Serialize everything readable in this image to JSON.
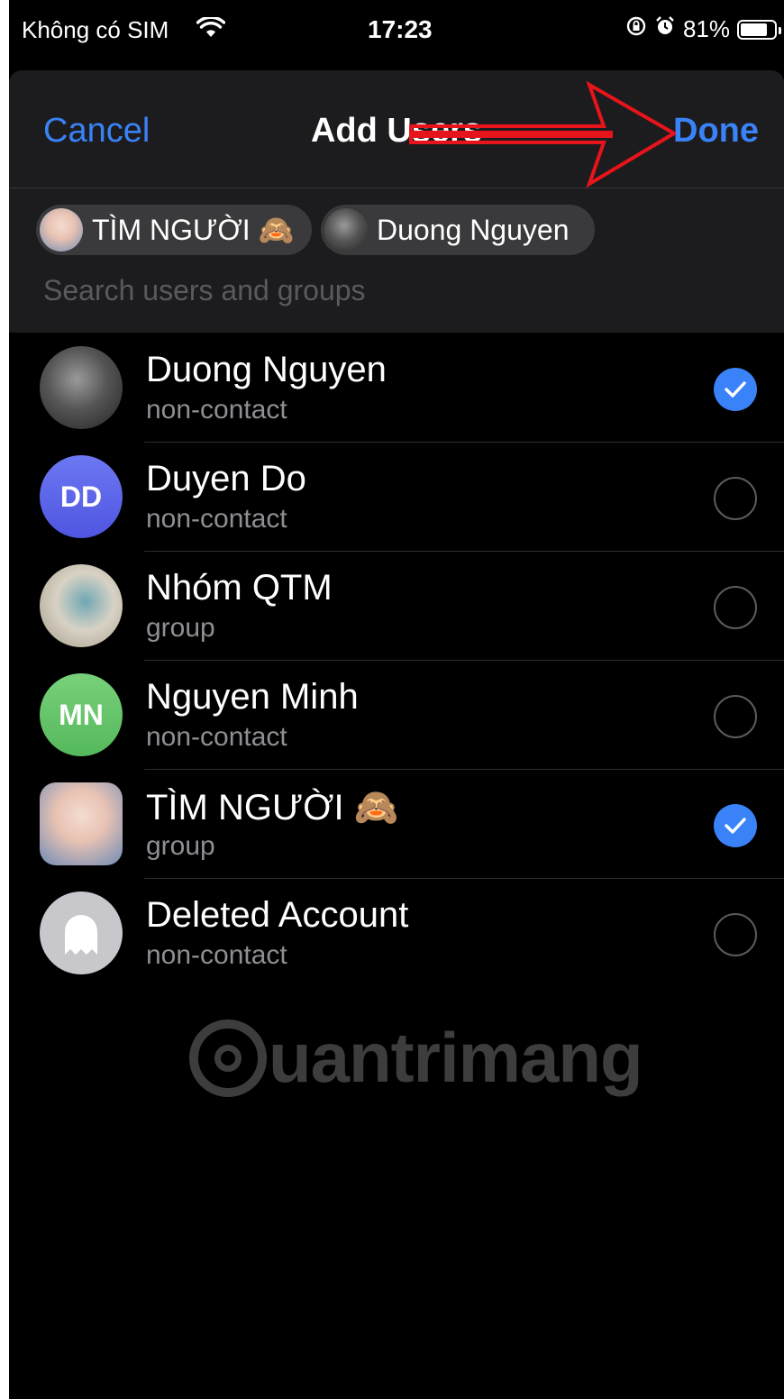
{
  "status_bar": {
    "carrier": "Không có SIM",
    "time": "17:23",
    "battery": "81%",
    "battery_level": 0.81
  },
  "nav": {
    "cancel_label": "Cancel",
    "title": "Add Users",
    "done_label": "Done"
  },
  "selected_chips": [
    {
      "label": "TÌM NGƯỜI 🙈"
    },
    {
      "label": "Duong Nguyen"
    }
  ],
  "search": {
    "placeholder": "Search users and groups",
    "value": ""
  },
  "list": [
    {
      "name": "Duong Nguyen",
      "subtitle": "non-contact",
      "avatar": "photo",
      "checked": true
    },
    {
      "name": "Duyen Do",
      "subtitle": "non-contact",
      "avatar_initials": "DD",
      "checked": false
    },
    {
      "name": "Nhóm QTM",
      "subtitle": "group",
      "avatar": "photo",
      "checked": false
    },
    {
      "name": "Nguyen Minh",
      "subtitle": "non-contact",
      "avatar_initials": "MN",
      "checked": false
    },
    {
      "name": "TÌM NGƯỜI 🙈",
      "subtitle": "group",
      "avatar": "photo",
      "checked": true
    },
    {
      "name": "Deleted Account",
      "subtitle": "non-contact",
      "avatar": "ghost-icon",
      "checked": false
    }
  ],
  "watermark": "uantrimang",
  "colors": {
    "accent": "#3a82f7",
    "annotation_arrow": "#e8141b",
    "background": "#000000",
    "header": "#1c1c1e"
  }
}
